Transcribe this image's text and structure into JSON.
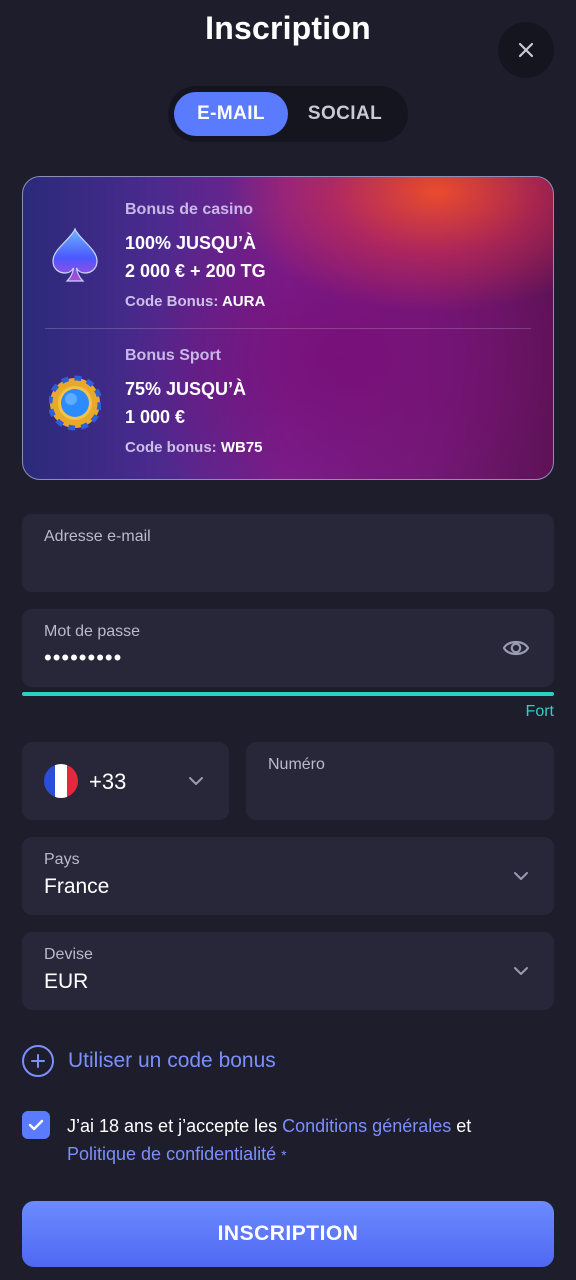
{
  "header": {
    "title": "Inscription",
    "close_icon": "close-icon"
  },
  "tabs": [
    {
      "label": "E-MAIL",
      "active": true
    },
    {
      "label": "SOCIAL",
      "active": false
    }
  ],
  "bonuses": [
    {
      "label": "Bonus de casino",
      "line1": "100% JUSQU’À",
      "line2": "2 000 € + 200 TG",
      "code_prefix": "Code Bonus:",
      "code": "AURA",
      "icon": "spade-icon"
    },
    {
      "label": "Bonus Sport",
      "line1": "75% JUSQU’À",
      "line2": "1 000 €",
      "code_prefix": "Code bonus:",
      "code": "WB75",
      "icon": "casino-chip-icon"
    }
  ],
  "form": {
    "email": {
      "label": "Adresse e-mail",
      "value": ""
    },
    "password": {
      "label": "Mot de passe",
      "value": "•••••••••",
      "strength_label": "Fort",
      "strength": 1.0
    },
    "phone": {
      "prefix": "+33",
      "number_label": "Numéro",
      "number_value": "",
      "flag": "france-flag-icon"
    },
    "country": {
      "label": "Pays",
      "value": "France"
    },
    "currency": {
      "label": "Devise",
      "value": "EUR"
    },
    "bonus_code_link": "Utiliser un code bonus",
    "terms": {
      "checked": true,
      "text_before": "J’ai 18 ans et j’accepte les ",
      "link1": "Conditions générales",
      "text_middle": " et",
      "link2": "Politique de confidentialité",
      "required_mark": "*"
    },
    "submit_label": "INSCRIPTION"
  },
  "colors": {
    "background": "#1d1d2c",
    "field_bg": "#272739",
    "accent": "#5b7bff",
    "link": "#7b8fff",
    "strength": "#2ad1c4"
  }
}
